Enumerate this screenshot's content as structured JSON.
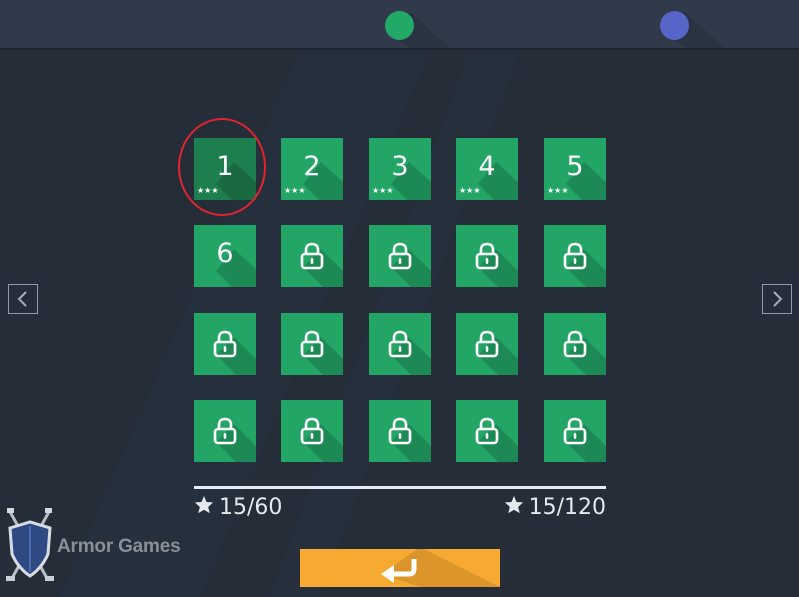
{
  "colors": {
    "background": "#252d39",
    "topbar": "#303a4a",
    "tile": "#23a566",
    "tile_selected": "#1e7f4e",
    "dot_active": "#22a867",
    "dot_inactive": "#5764c8",
    "highlight": "#e1242d",
    "back_button": "#f6aa32"
  },
  "pagination": {
    "pages": 2,
    "active": 1
  },
  "levels": [
    {
      "label": "1",
      "locked": false,
      "stars": "★★★",
      "selected": true
    },
    {
      "label": "2",
      "locked": false,
      "stars": "★★★",
      "selected": false
    },
    {
      "label": "3",
      "locked": false,
      "stars": "★★★",
      "selected": false
    },
    {
      "label": "4",
      "locked": false,
      "stars": "★★★",
      "selected": false
    },
    {
      "label": "5",
      "locked": false,
      "stars": "★★★",
      "selected": false
    },
    {
      "label": "6",
      "locked": false,
      "stars": "",
      "selected": false
    },
    {
      "label": "",
      "locked": true,
      "stars": "",
      "selected": false
    },
    {
      "label": "",
      "locked": true,
      "stars": "",
      "selected": false
    },
    {
      "label": "",
      "locked": true,
      "stars": "",
      "selected": false
    },
    {
      "label": "",
      "locked": true,
      "stars": "",
      "selected": false
    },
    {
      "label": "",
      "locked": true,
      "stars": "",
      "selected": false
    },
    {
      "label": "",
      "locked": true,
      "stars": "",
      "selected": false
    },
    {
      "label": "",
      "locked": true,
      "stars": "",
      "selected": false
    },
    {
      "label": "",
      "locked": true,
      "stars": "",
      "selected": false
    },
    {
      "label": "",
      "locked": true,
      "stars": "",
      "selected": false
    },
    {
      "label": "",
      "locked": true,
      "stars": "",
      "selected": false
    },
    {
      "label": "",
      "locked": true,
      "stars": "",
      "selected": false
    },
    {
      "label": "",
      "locked": true,
      "stars": "",
      "selected": false
    },
    {
      "label": "",
      "locked": true,
      "stars": "",
      "selected": false
    },
    {
      "label": "",
      "locked": true,
      "stars": "",
      "selected": false
    }
  ],
  "score": {
    "page_stars": "15/60",
    "total_stars": "15/120"
  },
  "icons": {
    "prev": "chevron-left-icon",
    "next": "chevron-right-icon",
    "lock": "lock-icon",
    "star": "star-icon",
    "back": "return-arrow-icon",
    "logo": "crossed-swords-shield-icon"
  },
  "branding": {
    "logo_text": "Armor Games"
  }
}
